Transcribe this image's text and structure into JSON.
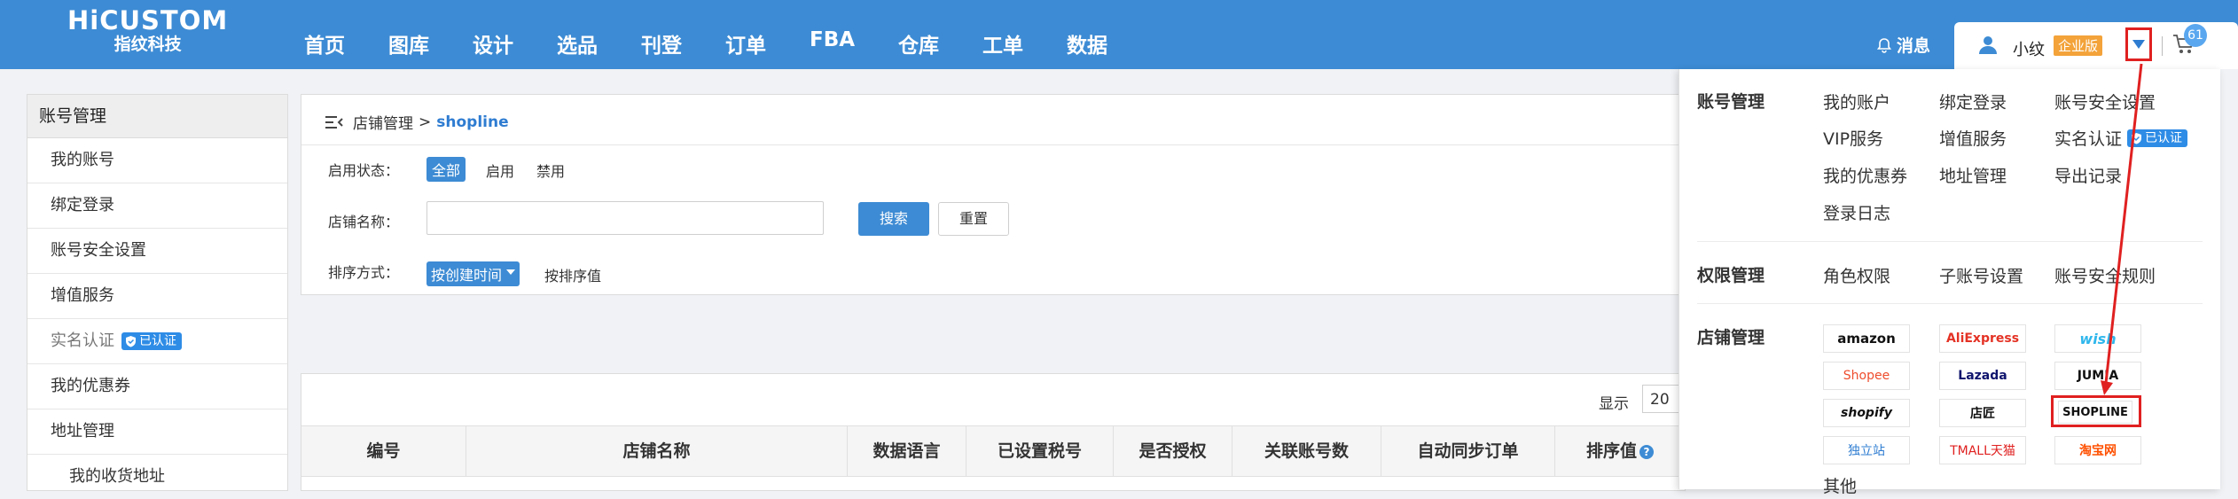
{
  "brand": {
    "name": "HiCUSTOM",
    "tagline": "指纹科技"
  },
  "nav": [
    "首页",
    "图库",
    "设计",
    "选品",
    "刊登",
    "订单",
    "FBA",
    "仓库",
    "工单",
    "数据"
  ],
  "header": {
    "messages_label": "消息",
    "username": "小纹",
    "edition_badge": "企业版",
    "cart_count": "61"
  },
  "sidebar": {
    "title": "账号管理",
    "items": [
      "我的账号",
      "绑定登录",
      "账号安全设置",
      "增值服务",
      "实名认证",
      "我的优惠券",
      "地址管理",
      "我的收货地址"
    ],
    "verified_badge": "已认证"
  },
  "breadcrumb": {
    "parent": "店铺管理",
    "separator": ">",
    "current": "shopline"
  },
  "filters": {
    "status_label": "启用状态：",
    "status_options": [
      "全部",
      "启用",
      "禁用"
    ],
    "name_label": "店铺名称：",
    "name_value": "",
    "search_button": "搜索",
    "reset_button": "重置",
    "sort_label": "排序方式：",
    "sort_selected": "按创建时间",
    "sort_other": "按排序值"
  },
  "table": {
    "show_label": "显示",
    "page_size": "20",
    "columns": [
      "编号",
      "店铺名称",
      "数据语言",
      "已设置税号",
      "是否授权",
      "关联账号数",
      "自动同步订单",
      "排序值"
    ],
    "help_icon_text": "?"
  },
  "menu": {
    "account_section": "账号管理",
    "account_links": [
      "我的账户",
      "绑定登录",
      "账号安全设置",
      "VIP服务",
      "增值服务",
      "实名认证",
      "我的优惠券",
      "地址管理",
      "导出记录",
      "登录日志"
    ],
    "verified_badge": "已认证",
    "permission_section": "权限管理",
    "permission_links": [
      "角色权限",
      "子账号设置",
      "账号安全规则"
    ],
    "store_section": "店铺管理",
    "store_logos": [
      "amazon",
      "AliExpress",
      "wish",
      "Shopee",
      "Lazada",
      "JUMIA",
      "shopify",
      "店匠",
      "SHOPLINE",
      "独立站",
      "TMALL天猫",
      "淘宝网"
    ],
    "other_label": "其他"
  },
  "colors": {
    "primary": "#3d8bd4",
    "highlight": "#e02020",
    "badge": "#f3a33a"
  },
  "icons": [
    "bell-icon",
    "user-icon",
    "chevron-down-icon",
    "cart-icon",
    "menu-collapse-icon",
    "shield-check-icon",
    "help-icon"
  ]
}
